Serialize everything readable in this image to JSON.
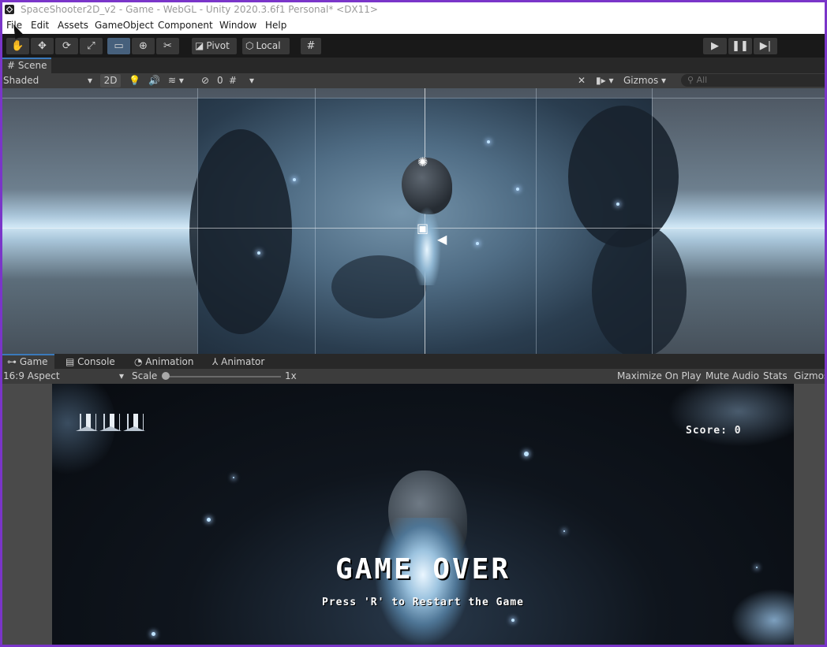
{
  "window": {
    "title": "SpaceShooter2D_v2 - Game - WebGL - Unity 2020.3.6f1 Personal* <DX11>"
  },
  "menu": [
    "File",
    "Edit",
    "Assets",
    "GameObject",
    "Component",
    "Window",
    "Help"
  ],
  "toolbar": {
    "tools": [
      "hand-tool-icon",
      "move-tool-icon",
      "rotate-tool-icon",
      "scale-tool-icon",
      "rect-tool-icon",
      "transform-tool-icon",
      "custom-tool-icon"
    ],
    "active_tool": "rect-tool-icon",
    "pivot_label": "Pivot",
    "local_label": "Local"
  },
  "scene": {
    "tab_label": "Scene",
    "draw_mode": "Shaded",
    "mode_2d": "2D",
    "hidden_count": "0",
    "gizmos_label": "Gizmos",
    "search_placeholder": "All"
  },
  "game_tabs": [
    "Game",
    "Console",
    "Animation",
    "Animator"
  ],
  "game_toolbar": {
    "aspect": "16:9 Aspect",
    "scale_label": "Scale",
    "scale_value": "1x",
    "scale_level": 0.0,
    "maximize": "Maximize On Play",
    "mute": "Mute Audio",
    "stats": "Stats",
    "gizmos": "Gizmos"
  },
  "game": {
    "lives_count": 3,
    "score_text": "Score: 0",
    "game_over_text": "GAME OVER",
    "restart_text": "Press 'R' to Restart the Game"
  },
  "colors": {
    "accent": "#3a79bb",
    "window_border": "#7a35c9",
    "panel": "#3c3c3c"
  }
}
